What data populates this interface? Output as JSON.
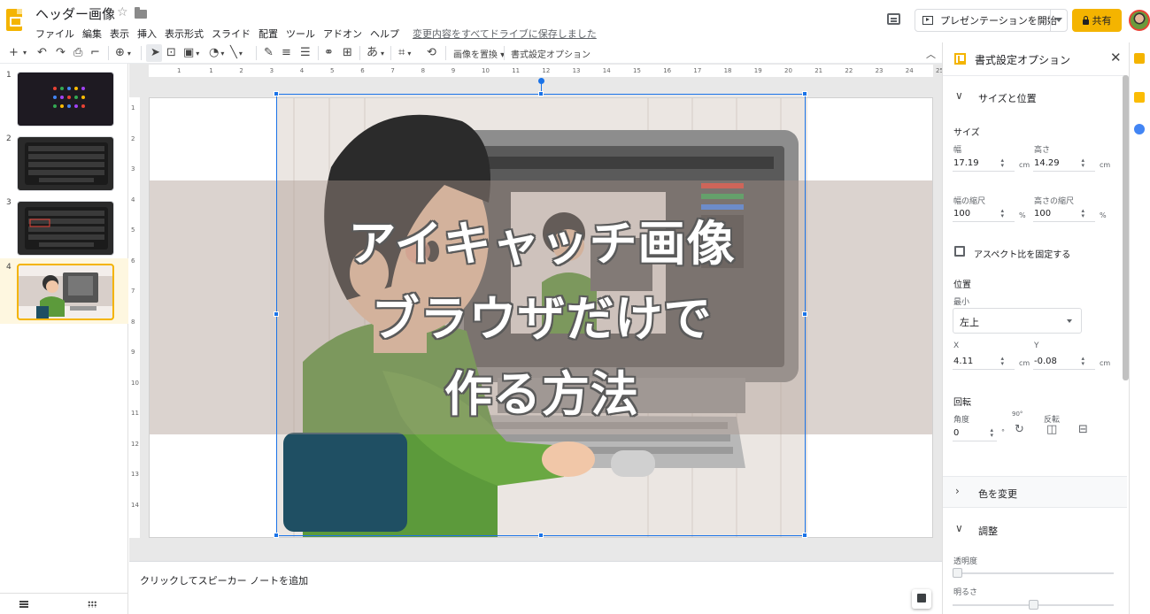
{
  "header": {
    "doc_title": "ヘッダー画像",
    "menu": [
      "ファイル",
      "編集",
      "表示",
      "挿入",
      "表示形式",
      "スライド",
      "配置",
      "ツール",
      "アドオン",
      "ヘルプ"
    ],
    "saved_status": "変更内容をすべてドライブに保存しました",
    "present_label": "プレゼンテーションを開始",
    "share_label": "共有"
  },
  "toolbar": {
    "undo": "↶",
    "redo": "↷",
    "zoom": "⊕",
    "replace_image_label": "画像を置換",
    "format_options_label": "書式設定オプション",
    "input_tool_label": "あ"
  },
  "filmstrip": {
    "slides": [
      {
        "number": "1"
      },
      {
        "number": "2"
      },
      {
        "number": "3"
      },
      {
        "number": "4"
      }
    ]
  },
  "rulers": {
    "top": [
      "1",
      "1",
      "2",
      "3",
      "4",
      "5",
      "6",
      "7",
      "8",
      "9",
      "10",
      "11",
      "12",
      "13",
      "14",
      "15",
      "16",
      "17",
      "18",
      "19",
      "20",
      "21",
      "22",
      "23",
      "24",
      "25"
    ],
    "left": [
      "1",
      "2",
      "3",
      "4",
      "5",
      "6",
      "7",
      "8",
      "9",
      "10",
      "11",
      "12",
      "13",
      "14"
    ]
  },
  "slide": {
    "lines": [
      "アイキャッチ画像",
      "ブラウザだけで",
      "作る方法"
    ]
  },
  "notes": {
    "placeholder": "クリックしてスピーカー ノートを追加"
  },
  "panel": {
    "title": "書式設定オプション",
    "size_section": {
      "title": "サイズと位置",
      "size_label": "サイズ",
      "width_label": "幅",
      "width_value": "17.19",
      "height_label": "高さ",
      "height_value": "14.29",
      "unit": "cm",
      "width_scale_label": "幅の縮尺",
      "width_scale_value": "100",
      "height_scale_label": "高さの縮尺",
      "height_scale_value": "100",
      "percent": "%",
      "lock_aspect_label": "アスペクト比を固定する",
      "position_label": "位置",
      "from_label": "最小",
      "from_value": "左上",
      "x_label": "X",
      "x_value": "4.11",
      "y_label": "Y",
      "y_value": "-0.08",
      "rotation_label": "回転",
      "angle_label": "角度",
      "angle_value": "0",
      "degree": "°",
      "rotate_90_label": "90°",
      "flip_label": "反転"
    },
    "recolor_section": {
      "title": "色を変更"
    },
    "adjust_section": {
      "title": "調整",
      "transparency_label": "透明度",
      "transparency": 0,
      "brightness_label": "明るさ",
      "brightness": 0.5
    }
  },
  "colors": {
    "accent": "#f4b400",
    "selection": "#1a73e8"
  }
}
